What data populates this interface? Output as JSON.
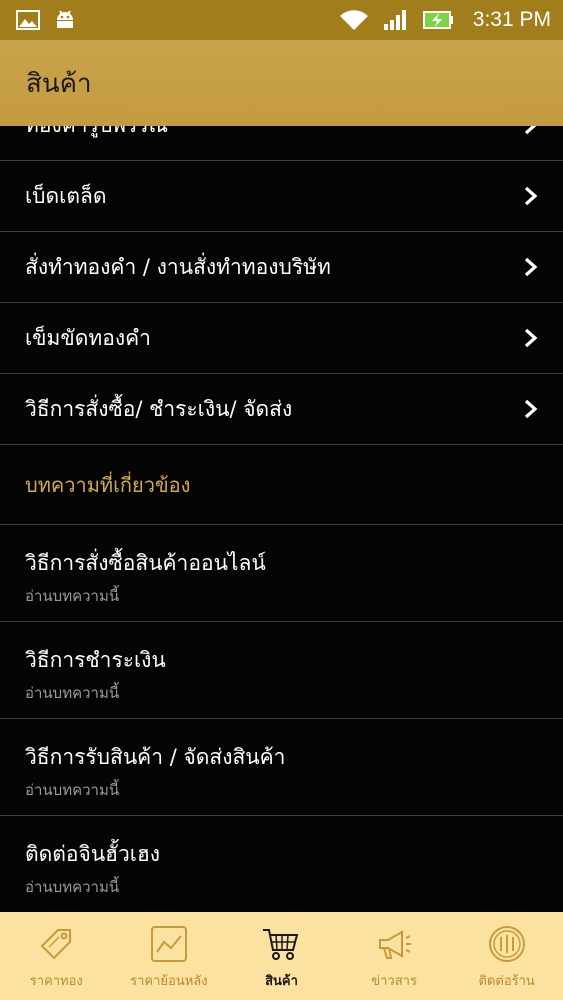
{
  "status_bar": {
    "time": "3:31 PM"
  },
  "app_bar": {
    "title": "สินค้า"
  },
  "menu": {
    "items": [
      {
        "label": "ทองคำรูปพรรณ"
      },
      {
        "label": "เบ็ดเตล็ด"
      },
      {
        "label": "สั่งทำทองคำ / งานสั่งทำทองบริษัท"
      },
      {
        "label": "เข็มขัดทองคำ"
      },
      {
        "label": "วิธีการสั่งซื้อ/ ชำระเงิน/ จัดส่ง"
      }
    ]
  },
  "articles": {
    "section_title": "บทความที่เกี่ยวข้อง",
    "items": [
      {
        "title": "วิธีการสั่งซื้อสินค้าออนไลน์",
        "sub": "อ่านบทความนี้"
      },
      {
        "title": "วิธีการชำระเงิน",
        "sub": "อ่านบทความนี้"
      },
      {
        "title": "วิธีการรับสินค้า / จัดส่งสินค้า",
        "sub": "อ่านบทความนี้"
      },
      {
        "title": "ติดต่อจินฮั้วเฮง",
        "sub": "อ่านบทความนี้"
      }
    ]
  },
  "bottom_nav": {
    "items": [
      {
        "label": "ราคาทอง",
        "icon": "price-tag-icon"
      },
      {
        "label": "ราคาย้อนหลัง",
        "icon": "chart-icon"
      },
      {
        "label": "สินค้า",
        "icon": "cart-icon",
        "active": true
      },
      {
        "label": "ข่าวสาร",
        "icon": "megaphone-icon"
      },
      {
        "label": "ติดต่อร้าน",
        "icon": "store-icon"
      }
    ]
  },
  "colors": {
    "status_bar": "#a27d1b",
    "app_bar": "#c49b40",
    "section_header": "#d5a94f",
    "bottom_nav": "#fbe2a1",
    "nav_inactive": "#b98a2a"
  }
}
